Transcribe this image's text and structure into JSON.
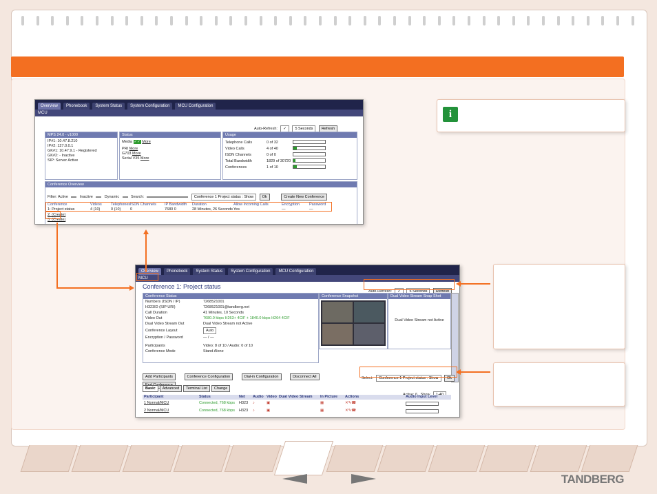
{
  "colors": {
    "accent": "#f36f21",
    "brand": "#777777",
    "ui_nav": "#20244a",
    "ok_green": "#2c9b2c"
  },
  "top_screen": {
    "tabs": [
      "Overview",
      "Phonebook",
      "System Status",
      "System Configuration",
      "MCU Configuration"
    ],
    "breadcrumb": "MCU",
    "auto_refresh_label": "Auto-Refresh:",
    "refresh_interval": "5 Seconds",
    "refresh_button": "Refresh",
    "system_panel": {
      "title": "MPS 24.0 - v1000",
      "rows": [
        "IP#1: 10.47.8.210",
        "IP#2: 127.0.0.1",
        "GK#1: 10.47.9.1 - Registered",
        "GK#2: - Inactive",
        "SIP: Server Active"
      ]
    },
    "status_panel": {
      "title": "Status",
      "media_label": "Media",
      "pri_label": "PRI",
      "g703_label": "G703",
      "serial_label": "Serial V35",
      "more": "More"
    },
    "usage_panel": {
      "title": "Usage",
      "rows": [
        {
          "label": "Telephone Calls",
          "value": "0 of 32",
          "level": 0
        },
        {
          "label": "Video Calls",
          "value": "4 of 40",
          "level": 0.1
        },
        {
          "label": "ISDN Channels",
          "value": "0 of 0",
          "level": 0
        },
        {
          "label": "Total Bandwidth",
          "value": "1829 of 30720",
          "level": 0.06
        },
        {
          "label": "Conferences",
          "value": "1 of 10",
          "level": 0.1
        }
      ]
    },
    "conf_overview": {
      "title": "Conference Overview",
      "filter_label": "Filter: Active",
      "inactive_label": "Inactive",
      "dynamic_label": "Dynamic",
      "search_label": "Search:",
      "select_value": "Conference 1 Project status : Show",
      "ok": "Ok",
      "create_button": "Create New Conference",
      "headers": [
        "Conference",
        "Videos",
        "Telephones",
        "ISDN Channels",
        "IP Bandwidth",
        "Duration",
        "Allow Incoming Calls",
        "Encryption",
        "Password"
      ],
      "rows": [
        [
          "1: Project status",
          "4 (10)",
          "0 (10)",
          "0",
          "7680 0",
          "28 Minutes, 26 Seconds",
          "Yes",
          "—",
          "—"
        ],
        [
          "2: (Create)"
        ],
        [
          "3: (Create)"
        ]
      ]
    }
  },
  "bottom_screen": {
    "tabs": [
      "Overview",
      "Phonebook",
      "System Status",
      "System Configuration",
      "MCU Configuration"
    ],
    "breadcrumb": "MCU",
    "title": "Conference 1: Project status",
    "auto_refresh_label": "Auto-Refresh:",
    "refresh_interval": "5 Seconds",
    "refresh_button": "Refresh",
    "status_title": "Conference Status",
    "status_rows": [
      [
        "Numbers (ISDN / IP)",
        "7268521001"
      ],
      [
        "H323ID (SIP URI)",
        "7268521001@tandberg.net"
      ],
      [
        "Call Duration",
        "41 Minutes, 10 Seconds"
      ],
      [
        "Video Out",
        "7680.0 kbps H263+ 4CIF + 1840.0 kbps H264 4CIF"
      ],
      [
        "Dual Video Stream Out",
        "Dual Video Stream not Active"
      ],
      [
        "Conference Layout",
        "Auto"
      ],
      [
        "Encryption / Password",
        "— / —"
      ],
      [
        "Participants",
        "Video: 8 of 10 / Audio: 0 of 10"
      ],
      [
        "Conference Mode",
        "Stand Alone"
      ]
    ],
    "snapshot_title": "Conference Snapshot",
    "dual_title": "Dual Video Stream Snap Shot",
    "dual_text": "Dual Video Stream not Active",
    "buttons": [
      "Add Participants",
      "Conference Configuration",
      "Dial-in Configuration",
      "Disconnect All"
    ],
    "end_conference": "End Conference",
    "select_label": "Select:",
    "select_value": "Conference 1 Project status : Show",
    "ok": "Ok",
    "subtabs": [
      "Basic",
      "Advanced",
      "Terminal List",
      "Change"
    ],
    "active_label": "Active: 6 , Show",
    "active_value": "1-40",
    "table_headers": [
      "Participant",
      "Status",
      "Net",
      "Audio",
      "Video",
      "Dual Video Stream",
      "In Picture",
      "Actions",
      "Audio Input Level"
    ],
    "rows": [
      [
        "1 Normal/MCU",
        "Connected, 768 kbps",
        "H323"
      ],
      [
        "2 Normal/MCU",
        "Connected, 768 kbps",
        "H323"
      ]
    ]
  },
  "nav": {
    "brand": "TANDBERG"
  }
}
